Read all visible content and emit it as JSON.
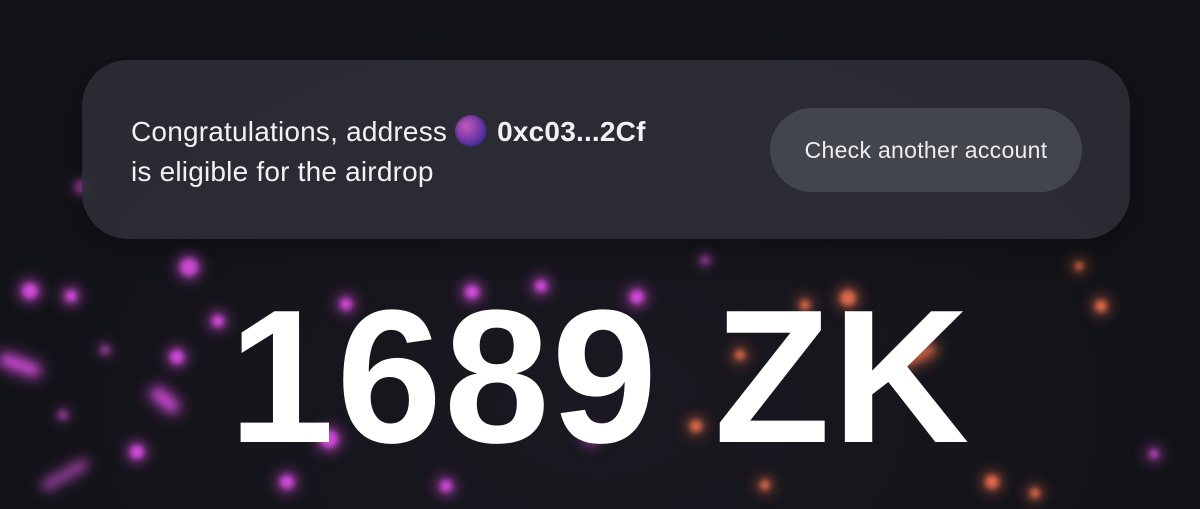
{
  "banner": {
    "message_prefix": "Congratulations, address",
    "address": "0xc03...2Cf",
    "message_suffix": "is eligible for the airdrop",
    "check_button_label": "Check another account"
  },
  "reward": {
    "amount_text": "1689 ZK"
  },
  "colors": {
    "background": "#131419",
    "banner": "#2c2e35",
    "button": "#43454d",
    "particle_pink": "#d04ad8",
    "particle_orange": "#e06a4a"
  }
}
